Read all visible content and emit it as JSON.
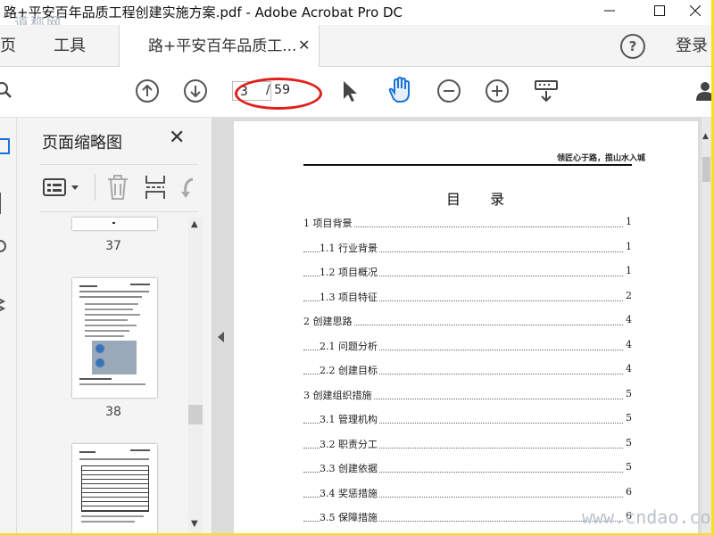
{
  "window": {
    "title": "路+平安百年品质工程创建实施方案.pdf - Adobe Acrobat Pro DC",
    "watermark_top": "道称网",
    "watermark_bottom": "www.cndao.com"
  },
  "tabs": {
    "home": "主页",
    "tools": "工具",
    "document": "路+平安百年品质工...",
    "login": "登录"
  },
  "toolbar": {
    "current_page": "3",
    "total_pages": "/ 59"
  },
  "thumbnail_panel": {
    "title": "页面缩略图",
    "pages": [
      "37",
      "38"
    ]
  },
  "document": {
    "header": "领匠心于路，揽山水入城",
    "toc_title": "目 录",
    "toc": [
      {
        "label": "1 项目背景",
        "page": "1",
        "level": 1
      },
      {
        "label": "1.1 行业背景",
        "page": "1",
        "level": 2
      },
      {
        "label": "1.2 项目概况",
        "page": "1",
        "level": 2
      },
      {
        "label": "1.3 项目特征",
        "page": "2",
        "level": 2
      },
      {
        "label": "2 创建思路",
        "page": "4",
        "level": 1
      },
      {
        "label": "2.1 问题分析",
        "page": "4",
        "level": 2
      },
      {
        "label": "2.2 创建目标",
        "page": "4",
        "level": 2
      },
      {
        "label": "3 创建组织措施",
        "page": "5",
        "level": 1
      },
      {
        "label": "3.1 管理机构",
        "page": "5",
        "level": 2
      },
      {
        "label": "3.2 职责分工",
        "page": "5",
        "level": 2
      },
      {
        "label": "3.3 创建依据",
        "page": "5",
        "level": 2
      },
      {
        "label": "3.4 奖惩措施",
        "page": "6",
        "level": 2
      },
      {
        "label": "3.5 保障措施",
        "page": "6",
        "level": 2
      }
    ]
  },
  "colors": {
    "annotation_red": "#e0201a",
    "hand_tool_blue": "#1a73d8",
    "frame_yellow": "#ffff00"
  }
}
